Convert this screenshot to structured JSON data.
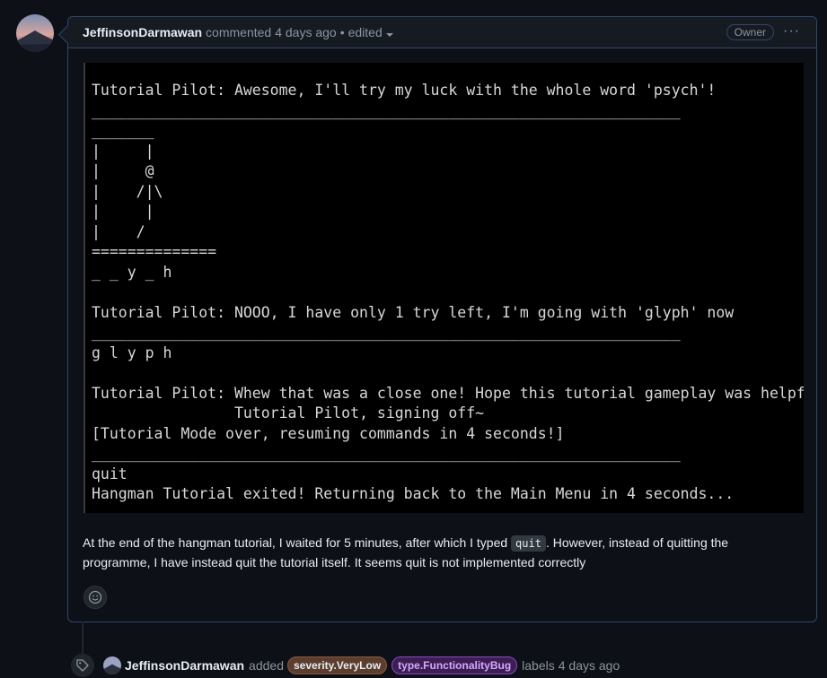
{
  "comment": {
    "author": "JeffinsonDarmawan",
    "action": "commented",
    "time": "4 days ago",
    "separator": "•",
    "edited": "edited",
    "role_badge": "Owner",
    "menu_glyph": "···"
  },
  "terminal": {
    "lines": [
      "Tutorial Pilot: Awesome, I'll try my luck with the whole word 'psych'!",
      "__________________________________________________________________",
      "_______",
      "|     |",
      "|     @",
      "|    /|\\",
      "|     |",
      "|    /",
      "==============",
      "_ _ y _ h",
      "",
      "Tutorial Pilot: NOOO, I have only 1 try left, I'm going with 'glyph' now",
      "__________________________________________________________________",
      "g l y p h",
      "",
      "Tutorial Pilot: Whew that was a close one! Hope this tutorial gameplay was helpful.",
      "                Tutorial Pilot, signing off~",
      "[Tutorial Mode over, resuming commands in 4 seconds!]",
      "__________________________________________________________________",
      "quit",
      "Hangman Tutorial exited! Returning back to the Main Menu in 4 seconds..."
    ]
  },
  "body": {
    "text_before": "At the end of the hangman tutorial, I waited for 5 minutes, after which I typed ",
    "code": "quit",
    "text_after": ". However, instead of quitting the programme, I have instead quit the tutorial itself. It seems quit is not implemented correctly"
  },
  "event": {
    "author": "JeffinsonDarmawan",
    "action": "added",
    "labels": [
      {
        "name": "severity.VeryLow",
        "color": "#5c3d2e"
      },
      {
        "name": "type.FunctionalityBug",
        "color": "#3c1f52"
      }
    ],
    "suffix": "labels",
    "time": "4 days ago"
  },
  "icons": {
    "avatar": "avatar-image",
    "reaction": "smiley-icon",
    "label_event": "tag-icon",
    "menu": "kebab-icon",
    "dropdown": "chevron-down-icon"
  }
}
